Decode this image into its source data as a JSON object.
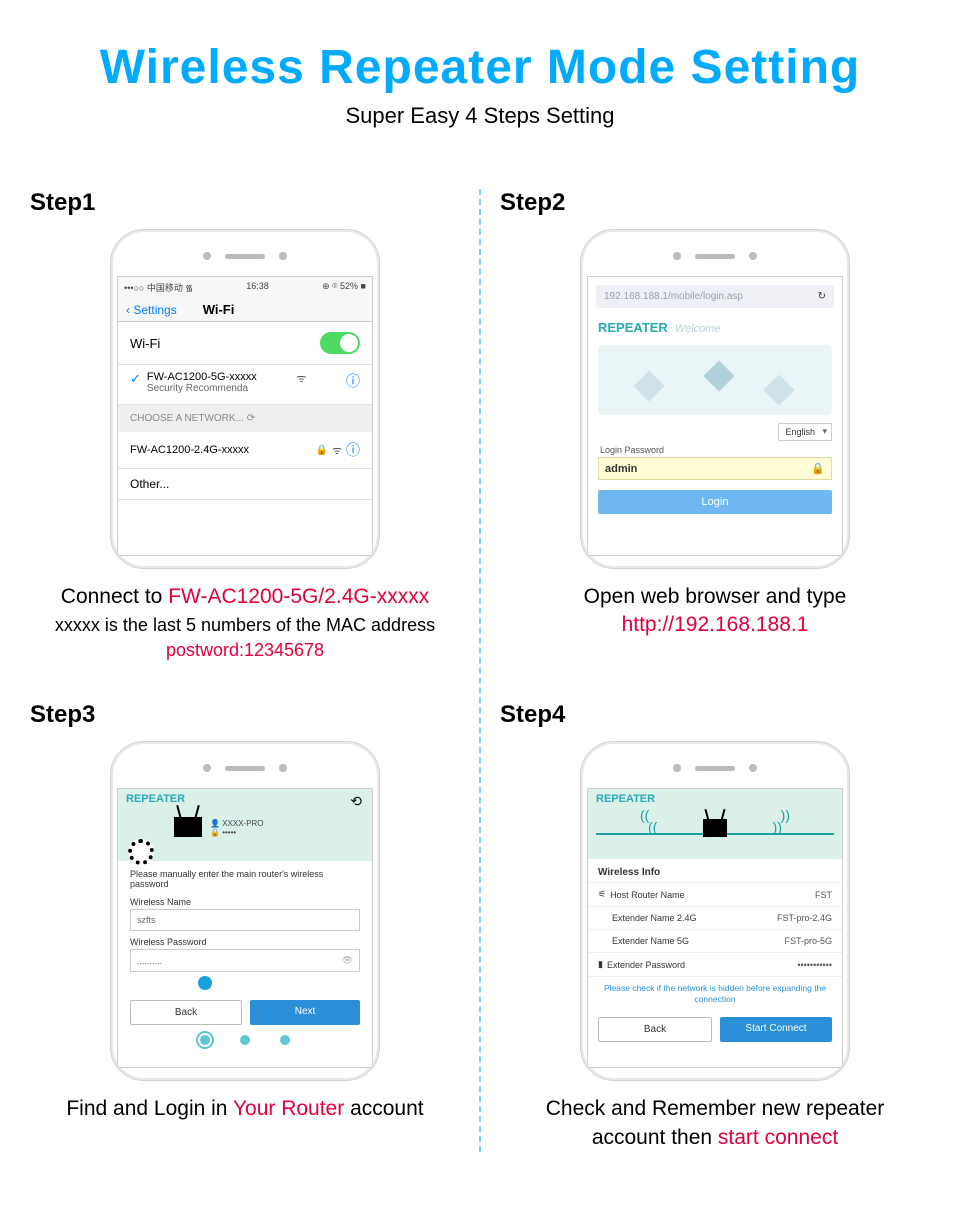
{
  "title": "Wireless Repeater Mode Setting",
  "subtitle": "Super Easy 4 Steps Setting",
  "steps": {
    "s1": {
      "label": "Step1",
      "statusbar_left": "•••○○ 中国移动 ᯾",
      "statusbar_time": "16:38",
      "statusbar_right": "⊕ ⌾ 52% ■",
      "back": "Settings",
      "nav_title": "Wi-Fi",
      "wifi_label": "Wi-Fi",
      "connected_ssid": "FW-AC1200-5G-xxxxx",
      "connected_sub": "Security Recommenda",
      "choose_label": "CHOOSE A NETWORK...",
      "other_ssid": "FW-AC1200-2.4G-xxxxx",
      "other_label": "Other...",
      "caption_pre": "Connect to ",
      "caption_hl": "FW-AC1200-5G/2.4G-xxxxx",
      "caption_sub": "xxxxx is the last 5 numbers of the MAC address",
      "caption_third": "postword:12345678"
    },
    "s2": {
      "label": "Step2",
      "url": "192.168.188.1/mobile/login.asp",
      "brand": "REPEATER",
      "welcome": "Welcome",
      "lang": "English",
      "login_pw_label": "Login Password",
      "login_value": "admin",
      "login_btn": "Login",
      "caption_line1": "Open web browser and type",
      "caption_hl": "http://192.168.188.1"
    },
    "s3": {
      "label": "Step3",
      "brand": "REPEATER",
      "user": "XXXX-PRO",
      "pass": "•••••",
      "note": "Please manually enter the main router's wireless password",
      "wname_label": "Wireless Name",
      "wname_value": "szfts",
      "wpass_label": "Wireless Password",
      "wpass_value": "..........",
      "btn_back": "Back",
      "btn_next": "Next",
      "caption_pre": "Find and Login in ",
      "caption_hl": "Your Router",
      "caption_post": " account"
    },
    "s4": {
      "label": "Step4",
      "brand": "REPEATER",
      "section": "Wireless Info",
      "rows": [
        {
          "k": "Host Router Name",
          "v": "FST"
        },
        {
          "k": "Extender Name 2.4G",
          "v": "FST-pro-2.4G"
        },
        {
          "k": "Extender Name 5G",
          "v": "FST-pro-5G"
        },
        {
          "k": "Extender Password",
          "v": "•••••••••••"
        }
      ],
      "warn": "Please check if the network is hidden before expanding the connection",
      "btn_back": "Back",
      "btn_start": "Start Connect",
      "caption_line1": "Check and Remember new repeater",
      "caption_pre2": "account then ",
      "caption_hl": "start connect"
    }
  }
}
